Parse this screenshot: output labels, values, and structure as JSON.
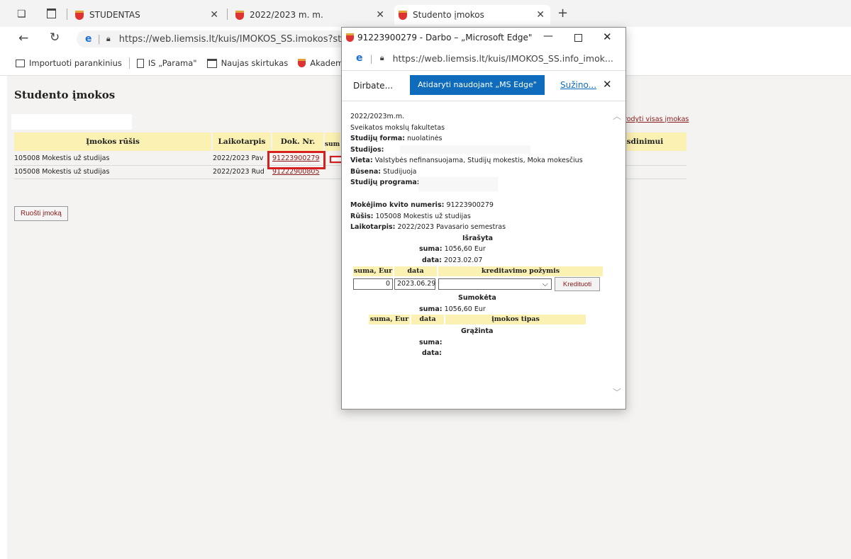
{
  "browser": {
    "tabs": [
      {
        "label": "STUDENTAS"
      },
      {
        "label": "2022/2023 m. m."
      },
      {
        "label": "Studento įmokos"
      }
    ],
    "address": "https://web.liemsis.lt/kuis/IMOKOS_SS.imokos?stu",
    "favorites": [
      "Importuoti parankinius",
      "IS „Parama\"",
      "Naujas skirtukas",
      "Akademinė i"
    ]
  },
  "page": {
    "title": "Studento įmokos",
    "show_all_link": "rodyti visas įmokas",
    "columns": [
      "Įmokos rūšis",
      "Laikotarpis",
      "Dok. Nr.",
      "sum",
      "usdinimui"
    ],
    "rows": [
      {
        "type": "105008 Mokestis už studijas",
        "period": "2022/2023 Pav",
        "doc": "91223900279"
      },
      {
        "type": "105008 Mokestis už studijas",
        "period": "2022/2023 Rud",
        "doc": "91222900805"
      }
    ],
    "prepare_button": "Ruošti įmoką"
  },
  "popup": {
    "title": "91223900279 - Darbo – „Microsoft Edge\"",
    "address": "https://web.liemsis.lt/kuis/IMOKOS_SS.info_imok...",
    "banner": {
      "text": "Dirbate...",
      "open_button": "Atidaryti naudojant „MS Edge\"",
      "learn_link": "Sužino..."
    },
    "info": {
      "year": "2022/2023m.m.",
      "faculty": "Sveikatos mokslų fakultetas",
      "form_label": "Studijų forma:",
      "form_value": "nuolatinės",
      "studies_label": "Studijos:",
      "place_label": "Vieta:",
      "place_value": "Valstybės nefinansuojama, Studijų mokestis, Moka mokesčius",
      "status_label": "Būsena:",
      "status_value": "Studijuoja",
      "program_label": "Studijų programa:",
      "receipt_label": "Mokėjimo kvito numeris:",
      "receipt_value": "91223900279",
      "kind_label": "Rūšis:",
      "kind_value": "105008 Mokestis už studijas",
      "period_label": "Laikotarpis:",
      "period_value": "2022/2023 Pavasario semestras"
    },
    "issued": {
      "heading": "Išrašyta",
      "sum_label": "suma:",
      "sum_value": "1056,60 Eur",
      "date_label": "data:",
      "date_value": "2023.02.07"
    },
    "credit_table": {
      "headers": [
        "suma, Eur",
        "data",
        "kreditavimo požymis"
      ],
      "sum_input": "0",
      "date_input": "2023.06.29",
      "credit_button": "Kredituoti"
    },
    "paid": {
      "heading": "Sumokėta",
      "sum_label": "suma:",
      "sum_value": "1056,60 Eur",
      "headers": [
        "suma, Eur",
        "data",
        "įmokos tipas"
      ]
    },
    "returned": {
      "heading": "Grąžinta",
      "sum_label": "suma:",
      "date_label": "data:"
    }
  },
  "colors": {
    "header_bg": "#fbf1b3",
    "link": "#8b1a1a",
    "highlight": "#d62020",
    "edge_blue": "#0f6cbd"
  }
}
